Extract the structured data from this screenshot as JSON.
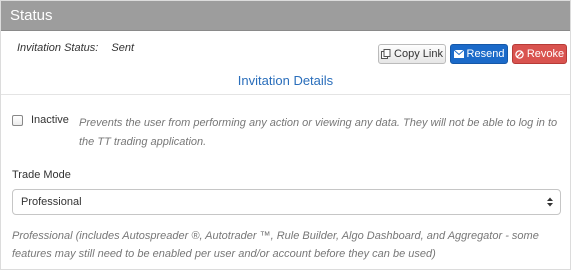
{
  "header": {
    "title": "Status"
  },
  "invitation": {
    "status_label": "Invitation Status:",
    "status_value": "Sent"
  },
  "actions": {
    "copy_link": "Copy Link",
    "resend": "Resend",
    "revoke": "Revoke"
  },
  "details": {
    "title": "Invitation Details"
  },
  "inactive": {
    "label": "Inactive",
    "checked": false,
    "help": "Prevents the user from performing any action or viewing any data. They will not be able to log in to the TT trading application."
  },
  "trade_mode": {
    "label": "Trade Mode",
    "selected": "Professional",
    "help": "Professional (includes Autospreader ®, Autotrader ™, Rule Builder, Algo Dashboard, and Aggregator - some features may still need to be enabled per user and/or account before they can be used)"
  },
  "colors": {
    "header_bg": "#9d9d9d",
    "resend": "#1b6ac9",
    "revoke": "#d9534f",
    "link_blue": "#2a6ebb"
  }
}
